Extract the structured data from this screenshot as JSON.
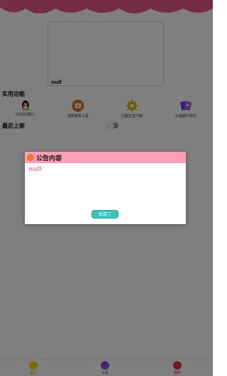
{
  "colors": {
    "header": "#ea5b86",
    "dialog_header": "#fb9fb8",
    "dialog_body_text": "#f08fb1",
    "ok_button": "#38c3bd",
    "tab_home": "#ffd200",
    "tab_tools": "#8a4ff0",
    "tab_mine": "#e8334a"
  },
  "banner": {
    "text": "null"
  },
  "sections": {
    "practical_title": "实用功能",
    "recent_title": "最近上架"
  },
  "features": [
    {
      "label": "QQ空间刷人",
      "icon": "penguin-icon"
    },
    {
      "label": "视频解析工具",
      "icon": "video-tool-icon"
    },
    {
      "label": "闪图生成下载",
      "icon": "gear-icon"
    },
    {
      "label": "头像图片制作",
      "icon": "photo-card-icon"
    }
  ],
  "tabbar": {
    "tabs": [
      {
        "label": "首页",
        "icon": "home-tab-icon"
      },
      {
        "label": "工具",
        "icon": "tools-tab-icon"
      },
      {
        "label": "我的",
        "icon": "mine-tab-icon"
      }
    ]
  },
  "dialog": {
    "title": "公告内容",
    "body": "null",
    "ok_label": "知道了"
  }
}
